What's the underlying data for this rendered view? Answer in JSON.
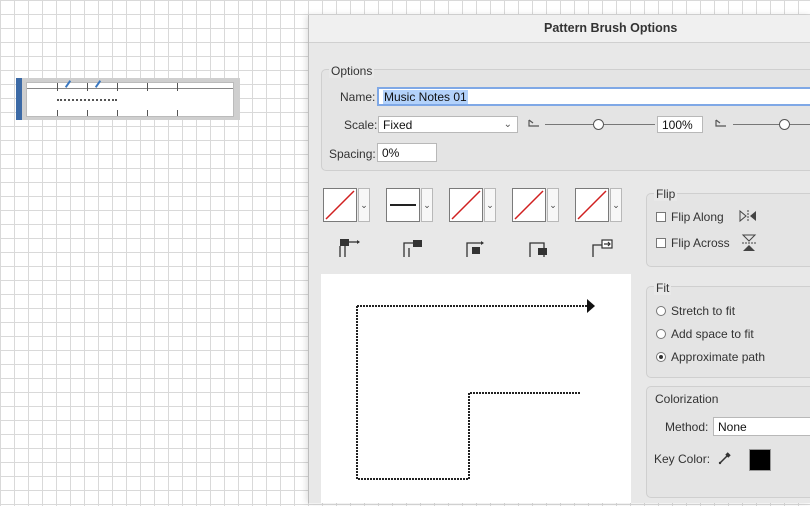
{
  "dialog": {
    "title": "Pattern Brush Options",
    "options_group": "Options",
    "name_label": "Name:",
    "name_value": "Music Notes 01",
    "scale_label": "Scale:",
    "scale_value": "Fixed",
    "scale_percent": "100%",
    "spacing_label": "Spacing:",
    "spacing_value": "0%",
    "flip": {
      "title": "Flip",
      "along": "Flip Along",
      "across": "Flip Across"
    },
    "fit": {
      "title": "Fit",
      "options": [
        "Stretch to fit",
        "Add space to fit",
        "Approximate path"
      ],
      "selected_index": 2
    },
    "colorization": {
      "title": "Colorization",
      "method_label": "Method:",
      "method_value": "None",
      "key_color_label": "Key Color:",
      "key_color": "#000000"
    },
    "tiles": [
      "side-tile-none",
      "outer-corner-tile-line",
      "inner-corner-tile-none",
      "start-tile-none",
      "end-tile-none"
    ],
    "tile_icons": [
      "side-tile-icon",
      "outer-corner-tile-icon",
      "inner-corner-tile-icon",
      "start-tile-icon",
      "end-tile-icon"
    ]
  },
  "colors": {
    "accent": "#3c6aa6",
    "focus": "#7fa8e6",
    "none_slash": "#d02020"
  }
}
